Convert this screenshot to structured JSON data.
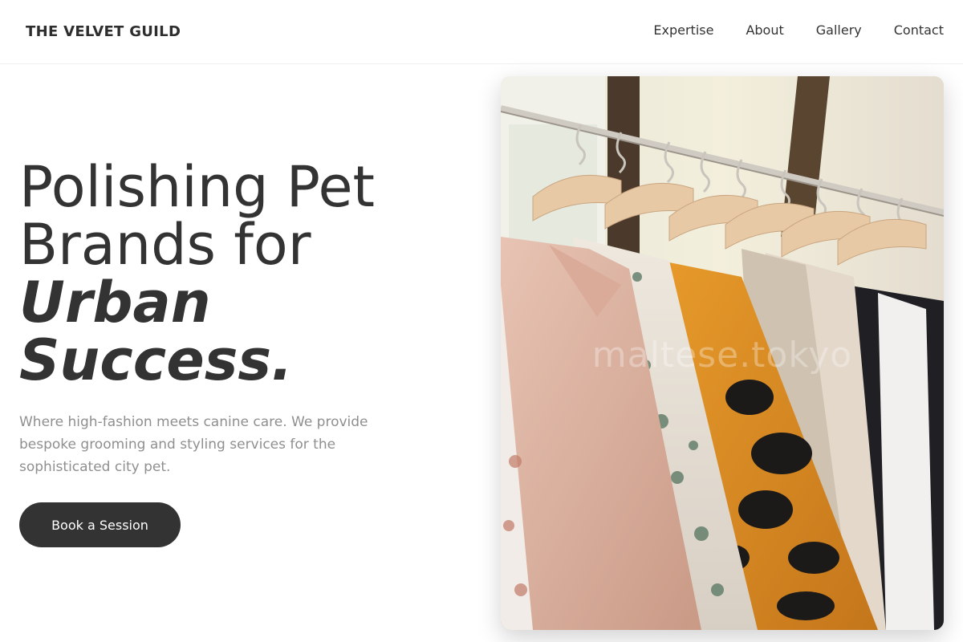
{
  "header": {
    "brand": "THE VELVET GUILD",
    "nav": [
      "Expertise",
      "About",
      "Gallery",
      "Contact"
    ]
  },
  "hero": {
    "title_lines": [
      "Polishing Pet",
      "Brands for"
    ],
    "title_emphasis": [
      "Urban",
      "Success."
    ],
    "subtitle": "Where high-fashion meets canine care. We provide bespoke grooming and styling services for the sophisticated city pet.",
    "cta_label": "Book a Session"
  },
  "image": {
    "watermark": "maltese.tokyo",
    "subject": "clothing rack with hanging garments"
  }
}
